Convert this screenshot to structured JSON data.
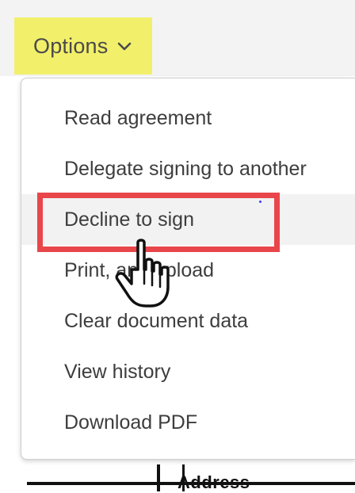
{
  "toolbar": {
    "options_label": "Options",
    "options_icon": "chevron-down-icon"
  },
  "menu": {
    "items": [
      {
        "label": "Read agreement"
      },
      {
        "label": "Delegate signing to another"
      },
      {
        "label": "Decline to sign"
      },
      {
        "label": "Print, and upload"
      },
      {
        "label": "Clear document data"
      },
      {
        "label": "View history"
      },
      {
        "label": "Download PDF"
      }
    ],
    "highlighted_index": 2
  },
  "document": {
    "field_label": "Address"
  },
  "colors": {
    "options_highlight": "#f2ef6a",
    "annotation_box": "#e8464b"
  },
  "cursor": {
    "icon": "hand-pointer-icon"
  }
}
